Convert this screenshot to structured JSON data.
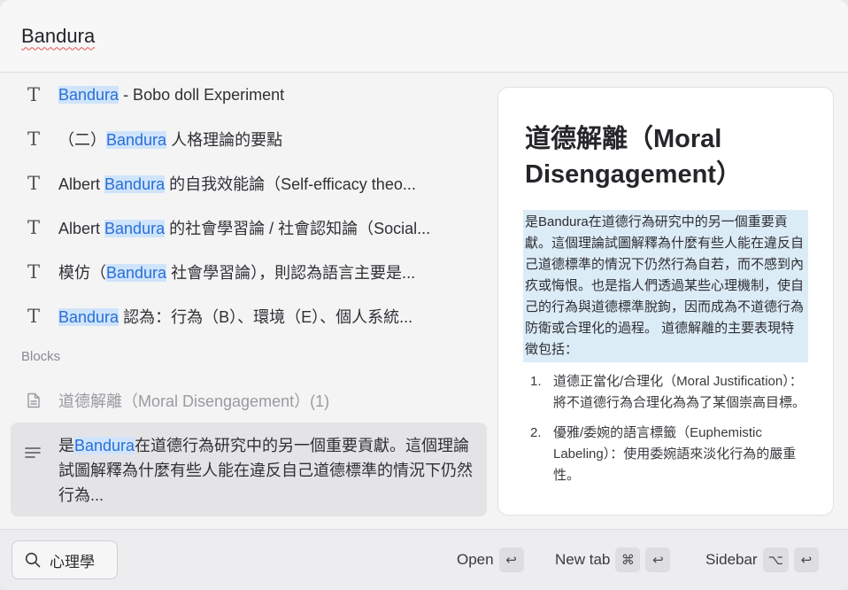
{
  "search": {
    "query": "Bandura"
  },
  "results": [
    {
      "before": "",
      "match": "Bandura",
      "after": " - Bobo doll Experiment"
    },
    {
      "before": "（二）",
      "match": "Bandura",
      "after": " 人格理論的要點"
    },
    {
      "before": "Albert ",
      "match": "Bandura",
      "after": " 的自我效能論（Self-efficacy theo..."
    },
    {
      "before": "Albert ",
      "match": "Bandura",
      "after": " 的社會學習論 / 社會認知論（Social..."
    },
    {
      "before": "模仿（",
      "match": "Bandura",
      "after": " 社會學習論），則認為語言主要是..."
    },
    {
      "before": "",
      "match": "Bandura",
      "after": " 認為：行為（B）、環境（E）、個人系統..."
    }
  ],
  "blocks_section": {
    "label": "Blocks"
  },
  "page_result": {
    "label": "道德解離（Moral Disengagement）(1)"
  },
  "block_result": {
    "before": "是",
    "match": "Bandura",
    "after": "在道德行為研究中的另一個重要貢獻。這個理論試圖解釋為什麼有些人能在違反自己道德標準的情況下仍然行為..."
  },
  "preview": {
    "title": "道德解離（Moral Disengagement）",
    "paragraph": "是Bandura在道德行為研究中的另一個重要貢獻。這個理論試圖解釋為什麼有些人能在違反自己道德標準的情況下仍然行為自若，而不感到內疚或悔恨。也是指人們透過某些心理機制，使自己的行為與道德標準脫鉤，因而成為不道德行為防衛或合理化的過程。 道德解離的主要表現特徵包括：",
    "list": [
      {
        "num": "1.",
        "text": "道德正當化/合理化（Moral Justification）：將不道德行為合理化為為了某個崇高目標。"
      },
      {
        "num": "2.",
        "text": "優雅/委婉的語言標籤（Euphemistic Labeling）：使用委婉語來淡化行為的嚴重性。"
      }
    ]
  },
  "footer": {
    "filter_label": "心理學",
    "open_label": "Open",
    "open_key": "↩",
    "newtab_label": "New tab",
    "newtab_mod": "⌘",
    "newtab_key": "↩",
    "sidebar_label": "Sidebar",
    "sidebar_mod": "⌥",
    "sidebar_key": "↩"
  },
  "colors": {
    "highlight_bg": "#cfe4fb",
    "highlight_text": "#2a6fd6",
    "preview_para_bg": "#dcecf7"
  }
}
